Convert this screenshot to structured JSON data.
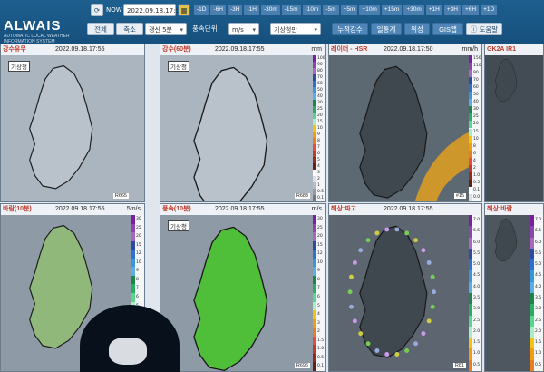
{
  "app": {
    "title": "ALWAIS",
    "subtitle": "AUTOMATIC LOCAL WEATHER\nINFORMATION SYSTEM"
  },
  "toolbar": {
    "now_label": "NOW",
    "datetime": "2022.09.18.17:55",
    "steps_top": [
      "-1D",
      "-6H",
      "-3H",
      "-1H",
      "-30m",
      "-15m",
      "-10m",
      "-5m",
      "+5m",
      "+10m",
      "+15m",
      "+30m",
      "+1H",
      "+3H",
      "+6H",
      "+1D"
    ],
    "full_label": "전체",
    "zoom_label": "축소",
    "interval_value": "갱신 5분",
    "wind_label": "풍속단위",
    "wind_value": "m/s",
    "agency_value": "기상청만",
    "tab_labels": [
      "누적강수",
      "일통계",
      "위성",
      "GIS맵"
    ],
    "help_label": "도움말"
  },
  "panels": [
    {
      "name": "강수유무",
      "time": "2022.09.18.17:55",
      "tag": "기상청",
      "code": "R665",
      "unit": ""
    },
    {
      "name": "강수(60분)",
      "time": "2022.09.18.17:55",
      "tag": "기상청",
      "code": "R683",
      "unit": "mm"
    },
    {
      "name": "레이더 - HSR",
      "time": "2022.09.18.17:50",
      "tag": "",
      "code": "#15",
      "unit": "mm/h"
    },
    {
      "name": "GK2A IR1",
      "time": "",
      "tag": "",
      "code": "",
      "unit": ""
    },
    {
      "name": "바람(10분)",
      "time": "2022.09.18.17:55",
      "tag": "",
      "code": "",
      "unit": "5m/s"
    },
    {
      "name": "풍속(10분)",
      "time": "2022.09.18.17:55",
      "tag": "기상청",
      "code": "R696",
      "unit": "m/s"
    },
    {
      "name": "해상:파고",
      "time": "2022.09.18.17:55",
      "tag": "",
      "code": "R81",
      "unit": ""
    },
    {
      "name": "해상:바람",
      "time": "",
      "tag": "",
      "code": "",
      "unit": ""
    }
  ],
  "colorbar_labels": {
    "precip": [
      "100",
      "90",
      "80",
      "70",
      "60",
      "50",
      "40",
      "30",
      "25",
      "20",
      "15",
      "10",
      "9",
      "8",
      "7",
      "6",
      "5",
      "4",
      "3",
      "2",
      "1",
      "0.5",
      "0.1"
    ],
    "radar": [
      "150",
      "110",
      "90",
      "70",
      "60",
      "50",
      "40",
      "30",
      "25",
      "20",
      "15",
      "10",
      "8",
      "6",
      "4",
      "2",
      "1.0",
      "0.5",
      "0.1",
      "0.0"
    ],
    "wind": [
      "30",
      "25",
      "20",
      "15",
      "12",
      "10",
      "9",
      "8",
      "7",
      "6",
      "5",
      "4",
      "3",
      "2",
      "1.5",
      "1.0",
      "0.5",
      "0.1"
    ],
    "wave": [
      "7.0",
      "6.5",
      "6.0",
      "5.5",
      "5.0",
      "4.5",
      "4.0",
      "3.5",
      "3.0",
      "2.5",
      "2.0",
      "1.5",
      "1.0",
      "0.5"
    ]
  },
  "colors": {
    "header": "#1d5f8f",
    "button": "#4f86b7",
    "accent_red": "#c0392b"
  }
}
